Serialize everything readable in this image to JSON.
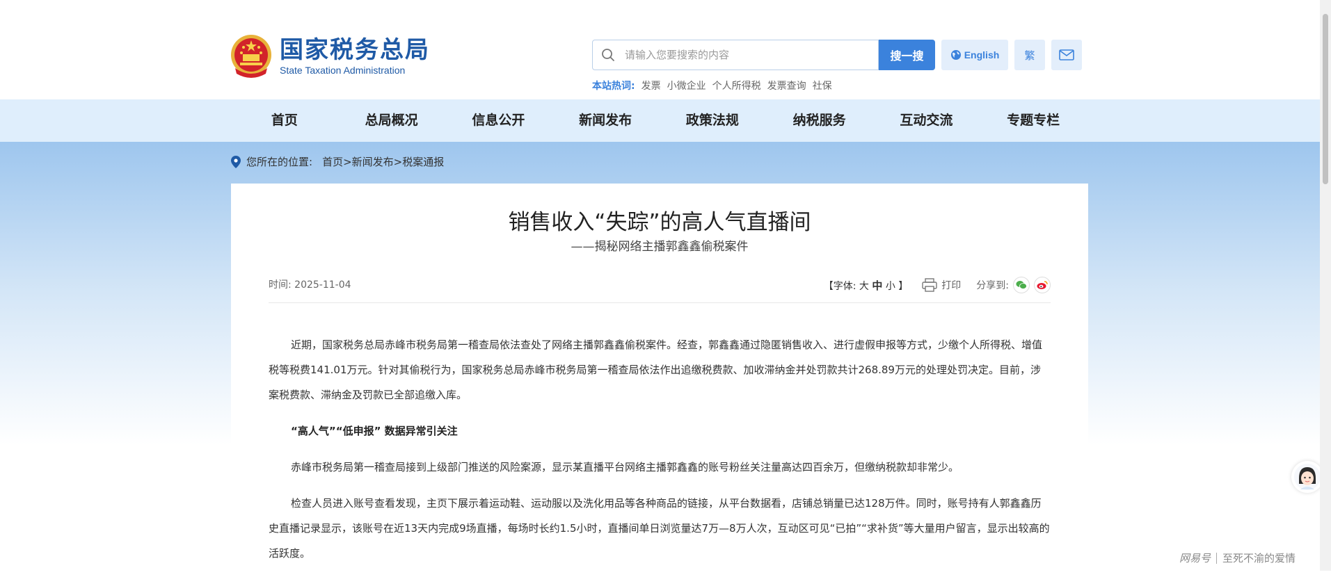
{
  "header": {
    "logo_cn": "国家税务总局",
    "logo_en": "State Taxation Administration",
    "search_placeholder": "请输入您要搜索的内容",
    "search_button": "搜一搜",
    "english_button": "English",
    "traditional_button": "繁",
    "hot_label": "本站热词:",
    "hot_words": [
      "发票",
      "小微企业",
      "个人所得税",
      "发票查询",
      "社保"
    ]
  },
  "nav": {
    "items": [
      "首页",
      "总局概况",
      "信息公开",
      "新闻发布",
      "政策法规",
      "纳税服务",
      "互动交流",
      "专题专栏"
    ]
  },
  "breadcrumb": {
    "label": "您所在的位置:",
    "path": [
      "首页",
      "新闻发布",
      "税案通报"
    ],
    "sep": ">"
  },
  "article": {
    "title": "销售收入“失踪”的高人气直播间",
    "subtitle": "——揭秘网络主播郭鑫鑫偷税案件",
    "time_label": "时间:",
    "time_value": "2025-11-04",
    "font_size_open": "【字体:",
    "font_large": "大",
    "font_medium": "中",
    "font_small": "小",
    "font_size_close": "】",
    "print_label": "打印",
    "share_label": "分享到:",
    "paragraphs": [
      "近期，国家税务总局赤峰市税务局第一稽查局依法查处了网络主播郭鑫鑫偷税案件。经查，郭鑫鑫通过隐匿销售收入、进行虚假申报等方式，少缴个人所得税、增值税等税费141.01万元。针对其偷税行为，国家税务总局赤峰市税务局第一稽查局依法作出追缴税费款、加收滞纳金并处罚款共计268.89万元的处理处罚决定。目前，涉案税费款、滞纳金及罚款已全部追缴入库。",
      "“高人气”“低申报” 数据异常引关注",
      "赤峰市税务局第一稽查局接到上级部门推送的风险案源，显示某直播平台网络主播郭鑫鑫的账号粉丝关注量高达四百余万，但缴纳税款却非常少。",
      "检查人员进入账号查看发现，主页下展示着运动鞋、运动服以及洗化用品等各种商品的链接，从平台数据看，店铺总销量已达128万件。同时，账号持有人郭鑫鑫历史直播记录显示，该账号在近13天内完成9场直播，每场时长约1.5小时，直播间单日浏览量达7万—8万人次，互动区可见“已拍”“求补货”等大量用户留言，显示出较高的活跃度。"
    ]
  },
  "watermark": {
    "brand": "网易号",
    "author": "至死不渝的爱情"
  },
  "colors": {
    "brand_blue": "#1f5aa6",
    "accent_blue": "#3b82dc",
    "nav_bg": "#dfeefc"
  }
}
